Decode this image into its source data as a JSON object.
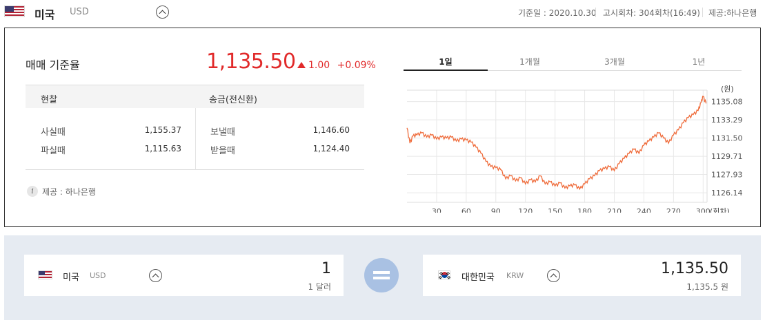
{
  "header": {
    "country": "미국",
    "currency": "USD",
    "base_date": "기준일 : 2020.10.30",
    "notice": "고시회차: 304회차(16:49)",
    "provider": "제공:하나은행"
  },
  "rate": {
    "title": "매매 기준율",
    "value": "1,135.50",
    "change": "1.00",
    "change_pct": "+0.09%"
  },
  "table": {
    "col_cash": "현찰",
    "col_remit": "송금(전신환)",
    "buy_label": "사실때",
    "buy_value": "1,155.37",
    "sell_label": "파실때",
    "sell_value": "1,115.63",
    "send_label": "보낼때",
    "send_value": "1,146.60",
    "receive_label": "받을때",
    "receive_value": "1,124.40"
  },
  "provider_note": "제공 : 하나은행",
  "tabs": [
    "1일",
    "1개월",
    "3개월",
    "1년"
  ],
  "active_tab": 0,
  "converter": {
    "from_country": "미국",
    "from_code": "USD",
    "from_amount": "1",
    "from_sub": "1 달러",
    "to_country": "대한민국",
    "to_code": "KRW",
    "to_amount": "1,135.50",
    "to_sub": "1,135.5 원"
  },
  "colors": {
    "accent": "#e12a2a",
    "line": "#ef6b3a",
    "converter_bg": "#e6ebf2",
    "equals": "#a9c1e3"
  },
  "chart_data": {
    "type": "line",
    "ylabel": "(원)",
    "xlabel": "(회차)",
    "x_ticks": [
      30,
      60,
      90,
      120,
      150,
      180,
      210,
      240,
      270,
      300
    ],
    "y_ticks": [
      "1135.08",
      "1133.29",
      "1131.50",
      "1129.71",
      "1127.93",
      "1126.14"
    ],
    "xlim": [
      0,
      304
    ],
    "ylim": [
      1125.2,
      1136.2
    ],
    "grid": true,
    "series": [
      {
        "x": [
          0,
          3,
          6,
          10,
          15,
          20,
          25,
          30,
          35,
          40,
          45,
          50,
          55,
          60,
          65,
          70,
          75,
          80,
          85,
          90,
          95,
          100,
          105,
          110,
          115,
          120,
          125,
          130,
          135,
          140,
          145,
          150,
          155,
          160,
          165,
          170,
          175,
          180,
          185,
          190,
          195,
          200,
          205,
          210,
          215,
          220,
          225,
          230,
          235,
          240,
          245,
          250,
          255,
          260,
          265,
          270,
          275,
          280,
          285,
          290,
          295,
          298,
          300,
          303
        ],
        "y": [
          1132.5,
          1131.0,
          1131.7,
          1131.8,
          1132.0,
          1131.6,
          1131.8,
          1131.4,
          1131.6,
          1131.5,
          1131.6,
          1131.2,
          1131.4,
          1131.3,
          1131.1,
          1130.6,
          1130.0,
          1129.2,
          1128.7,
          1128.6,
          1128.4,
          1127.5,
          1127.8,
          1127.3,
          1127.6,
          1127.0,
          1127.4,
          1127.2,
          1127.8,
          1127.0,
          1127.2,
          1126.8,
          1127.1,
          1126.6,
          1126.8,
          1126.9,
          1126.5,
          1127.0,
          1127.5,
          1127.8,
          1128.3,
          1128.5,
          1128.7,
          1128.3,
          1129.0,
          1129.5,
          1130.0,
          1130.4,
          1130.0,
          1130.8,
          1131.2,
          1131.6,
          1132.0,
          1131.5,
          1131.0,
          1131.8,
          1132.3,
          1133.0,
          1133.5,
          1133.8,
          1134.2,
          1135.0,
          1135.6,
          1134.9
        ]
      }
    ]
  }
}
